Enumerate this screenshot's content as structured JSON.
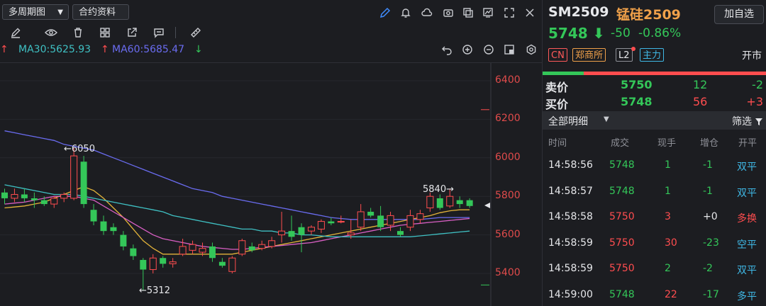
{
  "toolbar": {
    "period_label": "多周期图",
    "contract_info_label": "合约资料"
  },
  "indicators": {
    "ma30_label": "MA30:5625.93",
    "ma60_label": "MA60:5685.47",
    "ma30_color": "#3fc0c3",
    "ma60_color": "#6a6cf0"
  },
  "chart_data": {
    "type": "candlestick",
    "y_ticks": [
      "6400",
      "6200",
      "6000",
      "5800",
      "5600",
      "5400"
    ],
    "ylim": [
      5260,
      6480
    ],
    "annotations": {
      "high_label": "←6050",
      "low_label": "←5312",
      "recent_high_label": "5840→"
    },
    "candles": [
      {
        "o": 5820,
        "c": 5790,
        "h": 5840,
        "l": 5760
      },
      {
        "o": 5790,
        "c": 5810,
        "h": 5840,
        "l": 5770
      },
      {
        "o": 5810,
        "c": 5790,
        "h": 5840,
        "l": 5770
      },
      {
        "o": 5790,
        "c": 5780,
        "h": 5820,
        "l": 5740
      },
      {
        "o": 5780,
        "c": 5760,
        "h": 5800,
        "l": 5750
      },
      {
        "o": 5760,
        "c": 5790,
        "h": 5800,
        "l": 5740
      },
      {
        "o": 5790,
        "c": 5810,
        "h": 5820,
        "l": 5770
      },
      {
        "o": 5790,
        "c": 6010,
        "h": 6050,
        "l": 5780
      },
      {
        "o": 5980,
        "c": 5760,
        "h": 6010,
        "l": 5740
      },
      {
        "o": 5730,
        "c": 5670,
        "h": 5760,
        "l": 5650
      },
      {
        "o": 5670,
        "c": 5620,
        "h": 5700,
        "l": 5600
      },
      {
        "o": 5640,
        "c": 5620,
        "h": 5660,
        "l": 5600
      },
      {
        "o": 5600,
        "c": 5540,
        "h": 5620,
        "l": 5520
      },
      {
        "o": 5530,
        "c": 5490,
        "h": 5550,
        "l": 5470
      },
      {
        "o": 5470,
        "c": 5420,
        "h": 5480,
        "l": 5312
      },
      {
        "o": 5420,
        "c": 5480,
        "h": 5500,
        "l": 5400
      },
      {
        "o": 5480,
        "c": 5450,
        "h": 5490,
        "l": 5430
      },
      {
        "o": 5450,
        "c": 5460,
        "h": 5480,
        "l": 5430
      },
      {
        "o": 5500,
        "c": 5540,
        "h": 5580,
        "l": 5490
      },
      {
        "o": 5520,
        "c": 5550,
        "h": 5570,
        "l": 5500
      },
      {
        "o": 5510,
        "c": 5530,
        "h": 5560,
        "l": 5490
      },
      {
        "o": 5540,
        "c": 5480,
        "h": 5560,
        "l": 5460
      },
      {
        "o": 5460,
        "c": 5440,
        "h": 5480,
        "l": 5430
      },
      {
        "o": 5410,
        "c": 5480,
        "h": 5490,
        "l": 5400
      },
      {
        "o": 5500,
        "c": 5570,
        "h": 5580,
        "l": 5490
      },
      {
        "o": 5540,
        "c": 5520,
        "h": 5560,
        "l": 5510
      },
      {
        "o": 5530,
        "c": 5550,
        "h": 5570,
        "l": 5520
      },
      {
        "o": 5540,
        "c": 5570,
        "h": 5590,
        "l": 5530
      },
      {
        "o": 5600,
        "c": 5620,
        "h": 5720,
        "l": 5560
      },
      {
        "o": 5620,
        "c": 5590,
        "h": 5700,
        "l": 5570
      },
      {
        "o": 5640,
        "c": 5600,
        "h": 5660,
        "l": 5510
      },
      {
        "o": 5620,
        "c": 5640,
        "h": 5650,
        "l": 5600
      },
      {
        "o": 5630,
        "c": 5670,
        "h": 5680,
        "l": 5610
      },
      {
        "o": 5670,
        "c": 5660,
        "h": 5690,
        "l": 5650
      },
      {
        "o": 5670,
        "c": 5670,
        "h": 5700,
        "l": 5660
      },
      {
        "o": 5600,
        "c": 5610,
        "h": 5680,
        "l": 5580
      },
      {
        "o": 5640,
        "c": 5720,
        "h": 5760,
        "l": 5620
      },
      {
        "o": 5720,
        "c": 5700,
        "h": 5740,
        "l": 5690
      },
      {
        "o": 5700,
        "c": 5640,
        "h": 5750,
        "l": 5620
      },
      {
        "o": 5650,
        "c": 5700,
        "h": 5720,
        "l": 5620
      },
      {
        "o": 5620,
        "c": 5600,
        "h": 5640,
        "l": 5590
      },
      {
        "o": 5640,
        "c": 5700,
        "h": 5730,
        "l": 5620
      },
      {
        "o": 5680,
        "c": 5710,
        "h": 5730,
        "l": 5660
      },
      {
        "o": 5740,
        "c": 5800,
        "h": 5820,
        "l": 5720
      },
      {
        "o": 5790,
        "c": 5740,
        "h": 5810,
        "l": 5730
      },
      {
        "o": 5750,
        "c": 5800,
        "h": 5840,
        "l": 5740
      },
      {
        "o": 5780,
        "c": 5760,
        "h": 5800,
        "l": 5740
      },
      {
        "o": 5780,
        "c": 5750,
        "h": 5790,
        "l": 5740
      }
    ],
    "ma_lines": [
      {
        "color": "#e3b33a",
        "values": [
          5740,
          5745,
          5750,
          5760,
          5770,
          5790,
          5810,
          5830,
          5850,
          5830,
          5790,
          5740,
          5690,
          5630,
          5570,
          5530,
          5500,
          5500,
          5500,
          5500,
          5500,
          5500,
          5500,
          5500,
          5510,
          5520,
          5530,
          5540,
          5550,
          5560,
          5570,
          5580,
          5590,
          5600,
          5610,
          5620,
          5630,
          5640,
          5650,
          5660,
          5670,
          5680,
          5690,
          5700,
          5715,
          5725,
          5730,
          5730
        ]
      },
      {
        "color": "#d95fc4",
        "values": [
          5760,
          5765,
          5770,
          5780,
          5790,
          5800,
          5800,
          5800,
          5790,
          5780,
          5750,
          5720,
          5690,
          5660,
          5630,
          5600,
          5580,
          5570,
          5560,
          5550,
          5540,
          5535,
          5530,
          5525,
          5525,
          5530,
          5535,
          5540,
          5545,
          5550,
          5555,
          5560,
          5570,
          5580,
          5590,
          5600,
          5610,
          5620,
          5630,
          5640,
          5650,
          5655,
          5660,
          5665,
          5670,
          5675,
          5680,
          5685
        ]
      },
      {
        "color": "#3fc0c3",
        "values": [
          5860,
          5850,
          5840,
          5830,
          5820,
          5810,
          5810,
          5810,
          5800,
          5790,
          5780,
          5770,
          5760,
          5750,
          5740,
          5730,
          5720,
          5700,
          5690,
          5680,
          5670,
          5660,
          5650,
          5640,
          5630,
          5630,
          5620,
          5620,
          5610,
          5610,
          5600,
          5600,
          5595,
          5590,
          5590,
          5590,
          5590,
          5590,
          5590,
          5590,
          5590,
          5590,
          5595,
          5600,
          5605,
          5610,
          5615,
          5620
        ]
      },
      {
        "color": "#6a6cf0",
        "values": [
          6140,
          6130,
          6120,
          6110,
          6100,
          6090,
          6070,
          6060,
          6050,
          6040,
          6020,
          6000,
          5980,
          5960,
          5940,
          5920,
          5900,
          5880,
          5860,
          5840,
          5830,
          5820,
          5800,
          5790,
          5780,
          5770,
          5760,
          5750,
          5740,
          5730,
          5720,
          5710,
          5700,
          5690,
          5685,
          5680,
          5680,
          5680,
          5680,
          5680,
          5680,
          5680,
          5680,
          5685,
          5690,
          5690,
          5690,
          5690
        ]
      }
    ]
  },
  "quote": {
    "symbol": "SM2509",
    "name": "锰硅2509",
    "add_watch_label": "加自选",
    "last_price": "5748",
    "change": "-50",
    "change_pct": "-0.86%",
    "tags": [
      "CN",
      "郑商所",
      "L2",
      "主力"
    ],
    "status": "开市",
    "ask_label": "卖价",
    "ask_price": "5750",
    "ask_vol": "12",
    "ask_chg": "-2",
    "bid_label": "买价",
    "bid_price": "5748",
    "bid_vol": "56",
    "bid_chg": "+3"
  },
  "detail": {
    "title": "全部明细",
    "filter_label": "筛选",
    "headers": [
      "时间",
      "成交",
      "现手",
      "增仓",
      "开平"
    ],
    "rows": [
      {
        "time": "14:58:56",
        "price": "5748",
        "vol": "1",
        "oi": "-1",
        "type": "双平"
      },
      {
        "time": "14:58:57",
        "price": "5748",
        "vol": "1",
        "oi": "-1",
        "type": "双平"
      },
      {
        "time": "14:58:58",
        "price": "5750",
        "vol": "3",
        "oi": "+0",
        "type": "多换"
      },
      {
        "time": "14:58:59",
        "price": "5750",
        "vol": "30",
        "oi": "-23",
        "type": "空平"
      },
      {
        "time": "14:58:59",
        "price": "5750",
        "vol": "2",
        "oi": "-2",
        "type": "双平"
      },
      {
        "time": "14:59:00",
        "price": "5748",
        "vol": "22",
        "oi": "-17",
        "type": "多平"
      }
    ]
  }
}
